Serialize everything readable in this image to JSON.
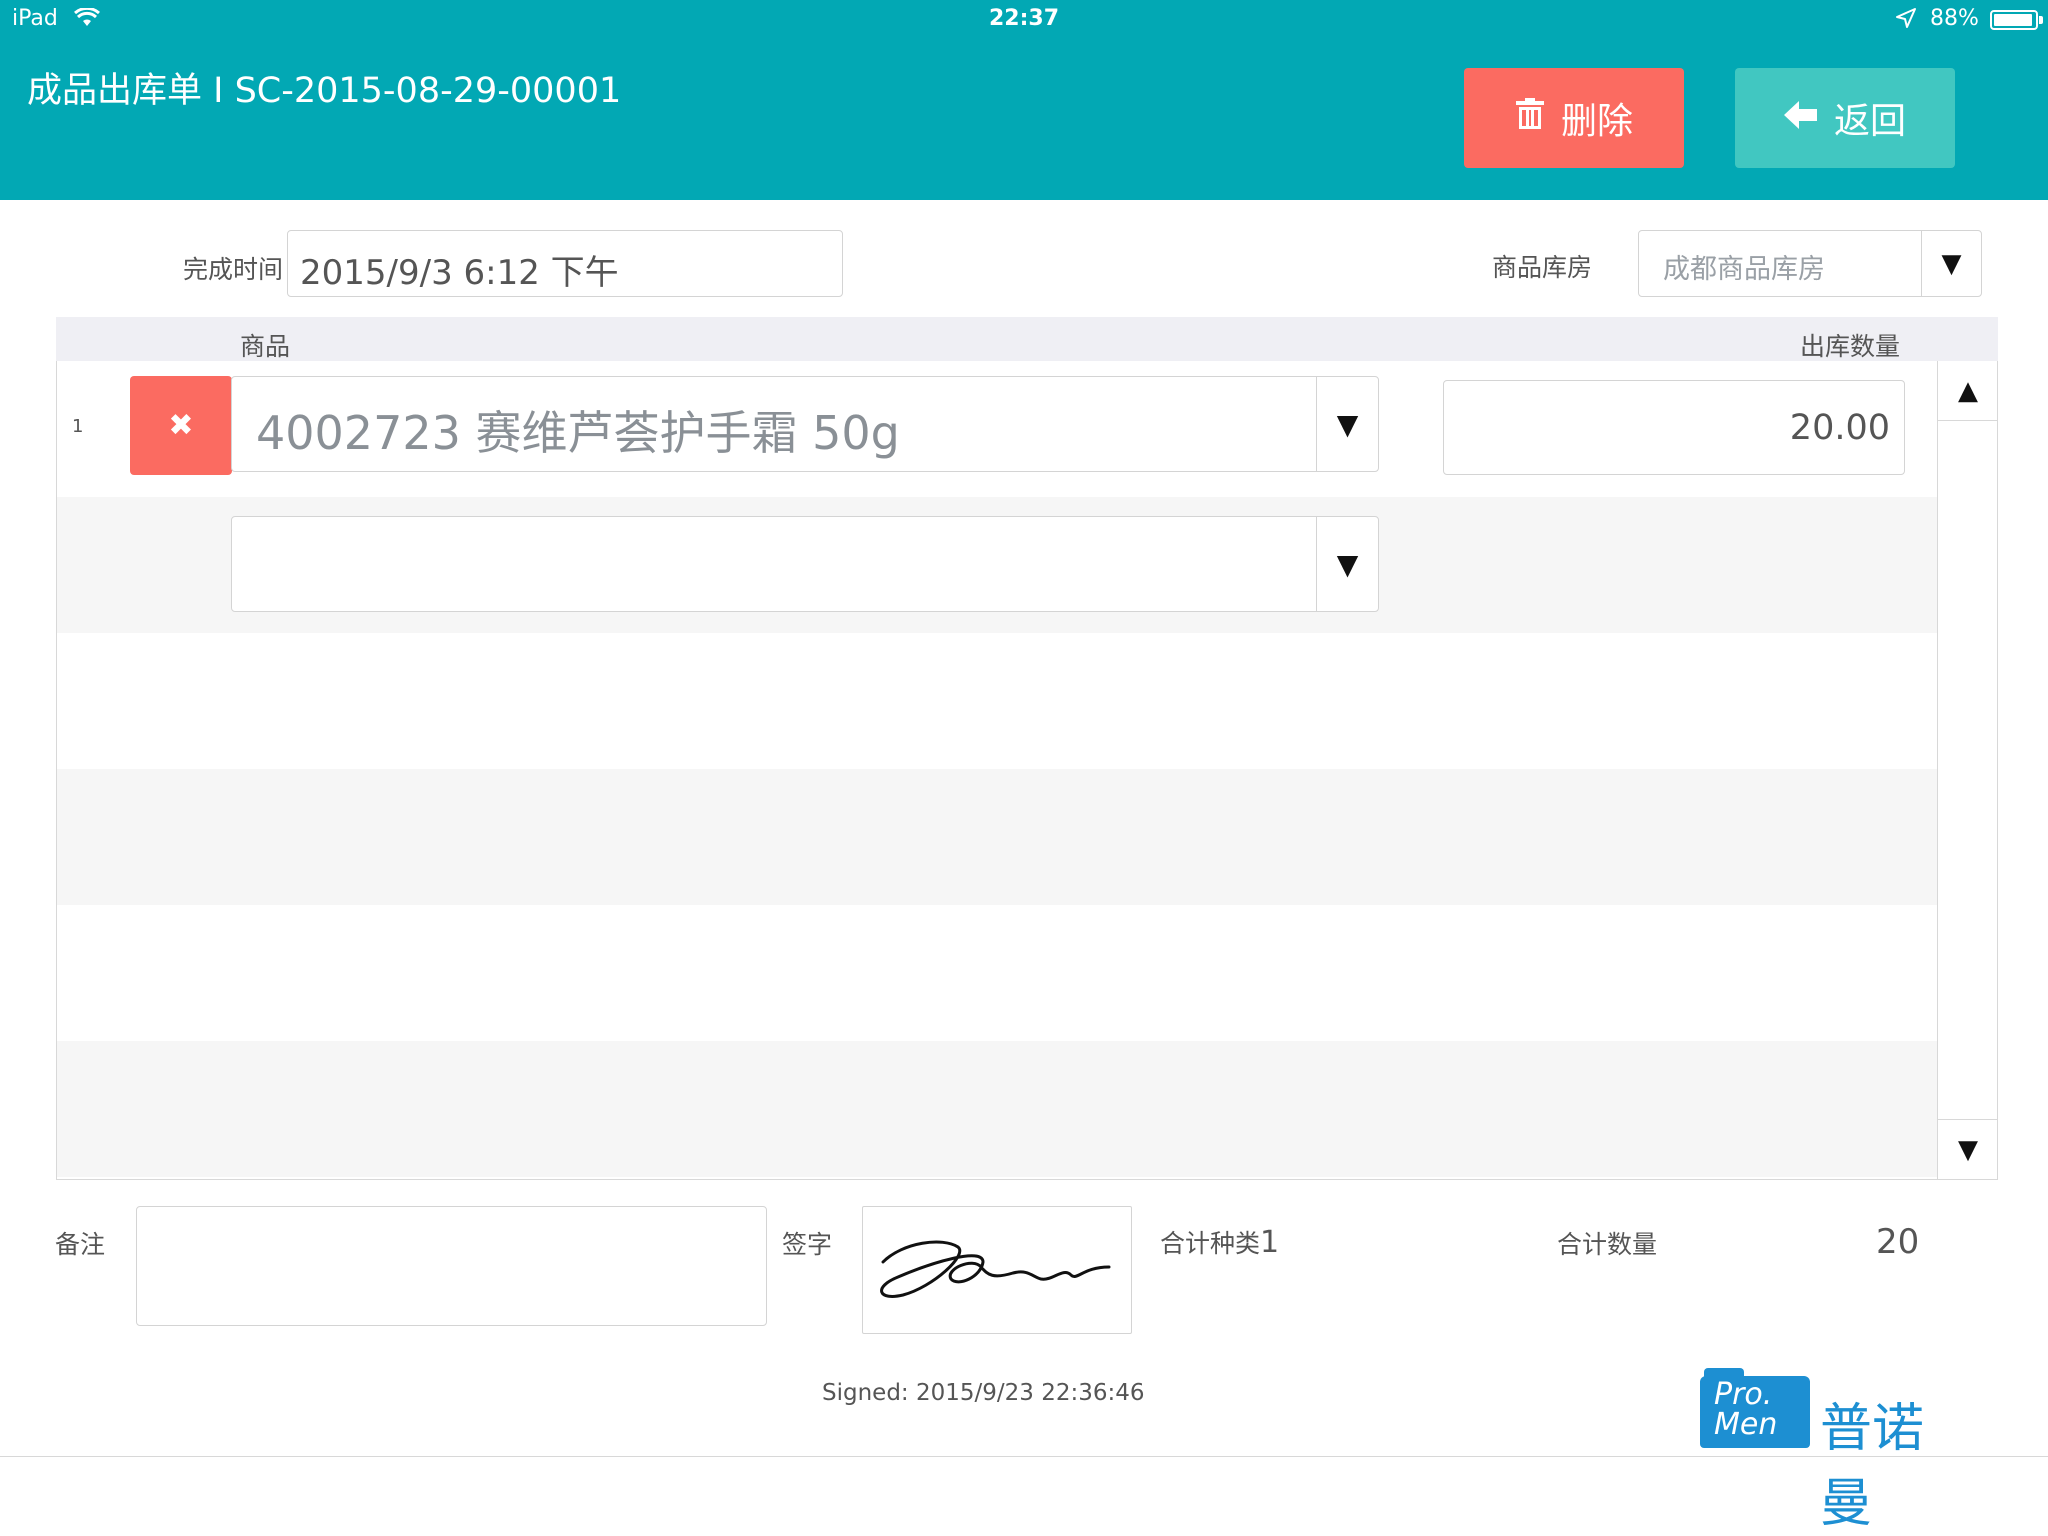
{
  "status_bar": {
    "device": "iPad",
    "time": "22:37",
    "battery": "88%",
    "battery_level": 0.88
  },
  "header": {
    "title": "成品出库单 I SC-2015-08-29-00001",
    "delete_label": "删除",
    "back_label": "返回"
  },
  "form": {
    "finish_time_label": "完成时间",
    "finish_time_value": "2015/9/3 6:12 下午",
    "warehouse_label": "商品库房",
    "warehouse_value": "成都商品库房"
  },
  "table": {
    "columns": [
      "商品",
      "出库数量"
    ],
    "rows": [
      {
        "index": "1",
        "product": "4002723  赛维芦荟护手霜 50g",
        "quantity": "20.00"
      }
    ]
  },
  "footer": {
    "note_label": "备注",
    "sign_label": "签字",
    "kinds_label": "合计种类",
    "kinds_value": "1",
    "total_qty_label": "合计数量",
    "total_qty_value": "20",
    "signed_text": "Signed: 2015/9/23 22:36:46",
    "logo_badge_line1": "Pro.",
    "logo_badge_line2": "Men",
    "logo_text": "普诺曼"
  },
  "colors": {
    "header_bg": "#02a8b4",
    "delete_bg": "#fb6b61",
    "back_bg": "#41c7c1",
    "logo": "#1d8fd2"
  },
  "icons": {
    "delete": "trash-icon",
    "back": "arrow-left-icon",
    "remove_row": "close-icon",
    "dropdown": "caret-down-icon",
    "scroll_up": "caret-up-icon",
    "scroll_down": "caret-down-icon"
  }
}
